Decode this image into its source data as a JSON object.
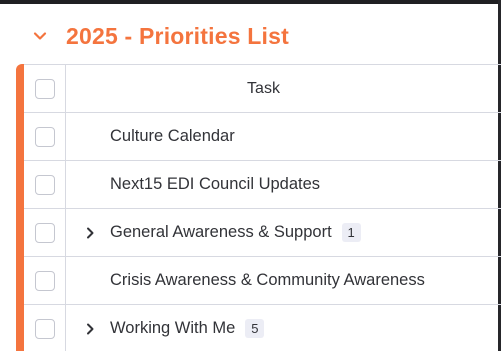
{
  "group": {
    "title": "2025 - Priorities List",
    "accent_color": "#f4743e",
    "collapse_icon": "chevron-down-icon"
  },
  "table": {
    "column_header": "Task",
    "rows": [
      {
        "label": "Culture Calendar",
        "has_subitems": false,
        "count": ""
      },
      {
        "label": "Next15 EDI Council Updates",
        "has_subitems": false,
        "count": ""
      },
      {
        "label": "General Awareness & Support",
        "has_subitems": true,
        "count": "1"
      },
      {
        "label": "Crisis Awareness & Community Awareness",
        "has_subitems": false,
        "count": ""
      },
      {
        "label": "Working With Me",
        "has_subitems": true,
        "count": "5"
      }
    ]
  }
}
